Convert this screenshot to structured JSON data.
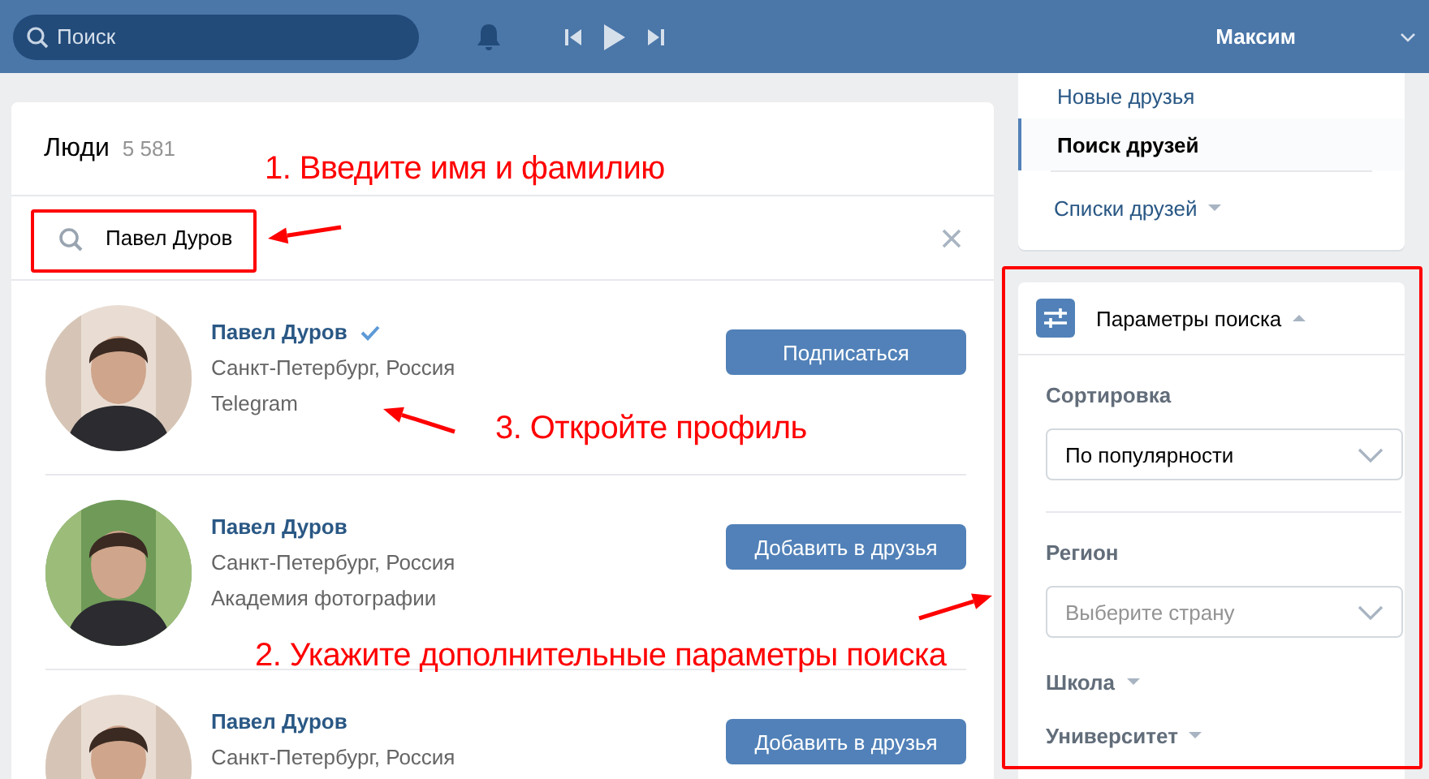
{
  "header": {
    "search": {
      "placeholder": "Поиск"
    },
    "user": "Максим"
  },
  "people": {
    "title": "Люди",
    "count": "5 581",
    "query": "Павел Дуров",
    "results": [
      {
        "name": "Павел Дуров",
        "verified": true,
        "city": "Санкт-Петербург, Россия",
        "detail": "Telegram",
        "action": "Подписаться"
      },
      {
        "name": "Павел Дуров",
        "verified": false,
        "city": "Санкт-Петербург, Россия",
        "detail": "Академия фотографии",
        "action": "Добавить в друзья"
      },
      {
        "name": "Павел Дуров",
        "verified": false,
        "city": "Санкт-Петербург, Россия",
        "action": "Добавить в друзья"
      }
    ]
  },
  "friends_menu": [
    {
      "label": "Новые друзья",
      "selected": false,
      "kind": "link"
    },
    {
      "label": "Поиск друзей",
      "selected": true,
      "kind": "link"
    },
    {
      "label": "Списки друзей",
      "selected": false,
      "kind": "dropdown"
    }
  ],
  "search_params": {
    "title": "Параметры поиска",
    "expanded": true,
    "sections": [
      {
        "kind": "select",
        "label": "Сортировка",
        "value": "По популярности"
      },
      {
        "kind": "select",
        "label": "Регион",
        "placeholder": "Выберите страну"
      },
      {
        "kind": "collapsible",
        "label": "Школа",
        "expanded": false
      },
      {
        "kind": "collapsible",
        "label": "Университет",
        "expanded": false
      }
    ]
  },
  "annotations": [
    {
      "text": "1. Введите имя и фамилию"
    },
    {
      "text": "3. Откройте профиль"
    },
    {
      "text": "2. Укажите дополнительные параметры поиска"
    }
  ]
}
